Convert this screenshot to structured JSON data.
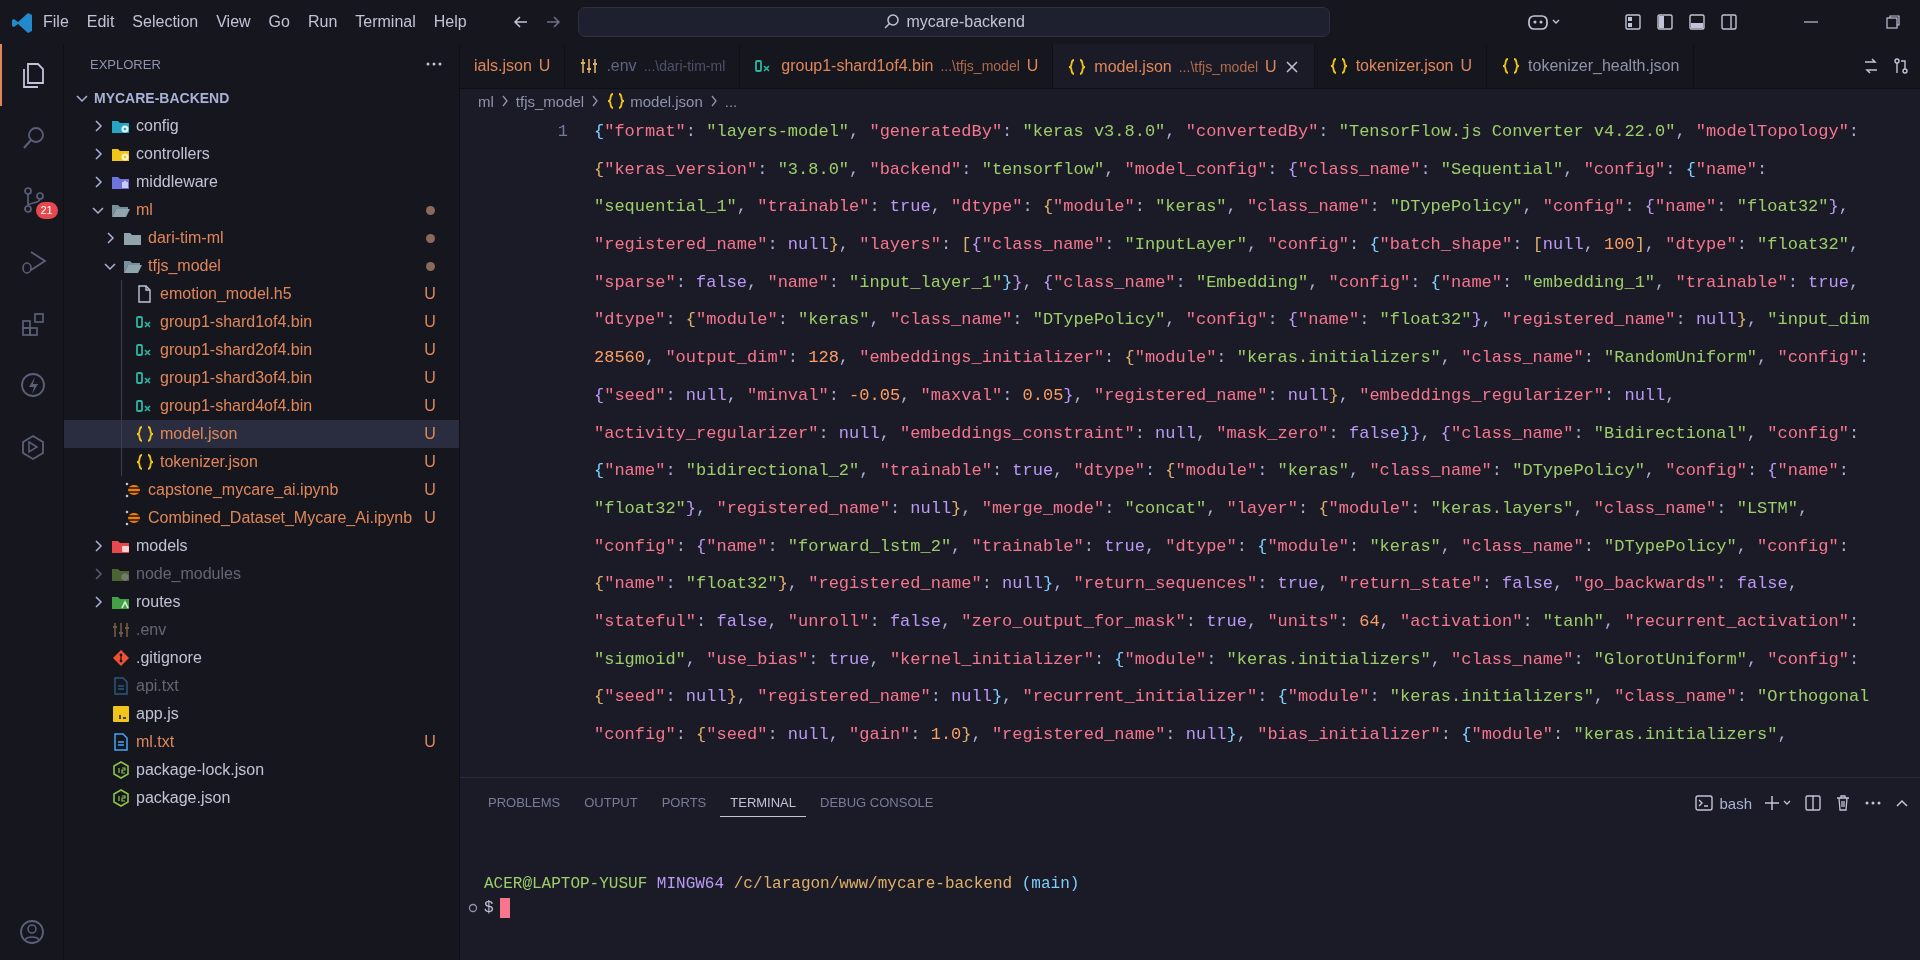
{
  "title_bar": {
    "menu": [
      "File",
      "Edit",
      "Selection",
      "View",
      "Go",
      "Run",
      "Terminal",
      "Help"
    ],
    "search": "mycare-backend"
  },
  "activity_bar": [
    {
      "kind": "files",
      "selected": true
    },
    {
      "kind": "search",
      "selected": false
    },
    {
      "kind": "source-control",
      "selected": false,
      "badge": "21"
    },
    {
      "kind": "run-debug",
      "selected": false
    },
    {
      "kind": "extensions",
      "selected": false
    },
    {
      "kind": "lightning",
      "selected": false
    },
    {
      "kind": "hexagon",
      "selected": false
    }
  ],
  "explorer": {
    "title": "EXPLORER",
    "root": {
      "label": "MYCARE-BACKEND",
      "expanded": true,
      "children": [
        {
          "label": "config",
          "kind": "folder-config",
          "expanded": false,
          "selected": false,
          "untracked": false,
          "ignored": false,
          "has_changes": false
        },
        {
          "label": "controllers",
          "kind": "folder-controllers",
          "expanded": false,
          "selected": false,
          "untracked": false,
          "ignored": false,
          "has_changes": false
        },
        {
          "label": "middleware",
          "kind": "folder-middleware",
          "expanded": false,
          "selected": false,
          "untracked": false,
          "ignored": false,
          "has_changes": false
        },
        {
          "label": "ml",
          "kind": "folder",
          "expanded": true,
          "selected": false,
          "untracked": true,
          "ignored": false,
          "has_changes": true,
          "children": [
            {
              "label": "dari-tim-ml",
              "kind": "folder",
              "expanded": false,
              "selected": false,
              "untracked": true,
              "ignored": false,
              "has_changes": true
            },
            {
              "label": "tfjs_model",
              "kind": "folder",
              "expanded": true,
              "selected": false,
              "untracked": true,
              "ignored": false,
              "has_changes": true,
              "children": [
                {
                  "label": "emotion_model.h5",
                  "kind": "file",
                  "selected": false,
                  "untracked": true,
                  "ignored": false,
                  "has_changes": false,
                  "badge": "U"
                },
                {
                  "label": "group1-shard1of4.bin",
                  "kind": "binary",
                  "selected": false,
                  "untracked": true,
                  "ignored": false,
                  "has_changes": false,
                  "badge": "U"
                },
                {
                  "label": "group1-shard2of4.bin",
                  "kind": "binary",
                  "selected": false,
                  "untracked": true,
                  "ignored": false,
                  "has_changes": false,
                  "badge": "U"
                },
                {
                  "label": "group1-shard3of4.bin",
                  "kind": "binary",
                  "selected": false,
                  "untracked": true,
                  "ignored": false,
                  "has_changes": false,
                  "badge": "U"
                },
                {
                  "label": "group1-shard4of4.bin",
                  "kind": "binary",
                  "selected": false,
                  "untracked": true,
                  "ignored": false,
                  "has_changes": false,
                  "badge": "U"
                },
                {
                  "label": "model.json",
                  "kind": "json",
                  "selected": true,
                  "untracked": true,
                  "ignored": false,
                  "has_changes": false,
                  "badge": "U"
                },
                {
                  "label": "tokenizer.json",
                  "kind": "json",
                  "selected": false,
                  "untracked": true,
                  "ignored": false,
                  "has_changes": false,
                  "badge": "U"
                }
              ]
            },
            {
              "label": "capstone_mycare_ai.ipynb",
              "kind": "notebook",
              "selected": false,
              "untracked": true,
              "ignored": false,
              "has_changes": false,
              "badge": "U"
            },
            {
              "label": "Combined_Dataset_Mycare_Ai.ipynb",
              "kind": "notebook",
              "selected": false,
              "untracked": true,
              "ignored": false,
              "has_changes": false,
              "badge": "U"
            }
          ]
        },
        {
          "label": "models",
          "kind": "folder-models",
          "expanded": false,
          "selected": false,
          "untracked": false,
          "ignored": false,
          "has_changes": false
        },
        {
          "label": "node_modules",
          "kind": "folder-node",
          "expanded": false,
          "selected": false,
          "untracked": false,
          "ignored": true,
          "has_changes": false
        },
        {
          "label": "routes",
          "kind": "folder-routes",
          "expanded": false,
          "selected": false,
          "untracked": false,
          "ignored": false,
          "has_changes": false
        },
        {
          "label": ".env",
          "kind": "env",
          "selected": false,
          "untracked": false,
          "ignored": true,
          "has_changes": false
        },
        {
          "label": ".gitignore",
          "kind": "git",
          "selected": false,
          "untracked": false,
          "ignored": false,
          "has_changes": false
        },
        {
          "label": "api.txt",
          "kind": "text",
          "selected": false,
          "untracked": false,
          "ignored": true,
          "has_changes": false
        },
        {
          "label": "app.js",
          "kind": "js",
          "selected": false,
          "untracked": false,
          "ignored": false,
          "has_changes": false
        },
        {
          "label": "ml.txt",
          "kind": "text",
          "selected": false,
          "untracked": true,
          "ignored": false,
          "has_changes": false,
          "badge": "U"
        },
        {
          "label": "package-lock.json",
          "kind": "nodejs",
          "selected": false,
          "untracked": false,
          "ignored": false,
          "has_changes": false
        },
        {
          "label": "package.json",
          "kind": "nodejs",
          "selected": false,
          "untracked": false,
          "ignored": false,
          "has_changes": false
        }
      ]
    }
  },
  "tabs": [
    {
      "label": "ials.json",
      "kind": "cut",
      "untracked": true,
      "ignored": false,
      "badge": "U",
      "selected": false
    },
    {
      "label": ".env",
      "kind": "env",
      "description": "...\\dari-tim-ml",
      "untracked": false,
      "ignored": true,
      "selected": false
    },
    {
      "label": "group1-shard1of4.bin",
      "kind": "binary",
      "description": "...\\tfjs_model",
      "untracked": true,
      "ignored": false,
      "badge": "U",
      "selected": false
    },
    {
      "label": "model.json",
      "kind": "json",
      "description": "...\\tfjs_model",
      "untracked": true,
      "ignored": false,
      "badge": "U",
      "selected": true
    },
    {
      "label": "tokenizer.json",
      "kind": "json",
      "untracked": true,
      "ignored": false,
      "badge": "U",
      "selected": false
    },
    {
      "label": "tokenizer_health.json",
      "kind": "json",
      "untracked": false,
      "ignored": false,
      "selected": false
    }
  ],
  "breadcrumb": [
    {
      "label": "ml",
      "kind": "folder"
    },
    {
      "label": "tfjs_model",
      "kind": "folder"
    },
    {
      "label": "model.json",
      "kind": "json"
    },
    {
      "label": "...",
      "kind": "more"
    }
  ],
  "editor": {
    "lines": [
      {
        "number": "1",
        "wrapped": [
          "{\"format\": \"layers-model\", \"generatedBy\": \"keras v3.8.0\", \"convertedBy\": \"TensorFlow.js Converter v4.22.0\", \"modelTopology\":",
          "{\"keras_version\": \"3.8.0\", \"backend\": \"tensorflow\", \"model_config\": {\"class_name\": \"Sequential\", \"config\": {\"name\":",
          "\"sequential_1\", \"trainable\": true, \"dtype\": {\"module\": \"keras\", \"class_name\": \"DTypePolicy\", \"config\": {\"name\": \"float32\"},",
          "\"registered_name\": null}, \"layers\": [{\"class_name\": \"InputLayer\", \"config\": {\"batch_shape\": [null, 100], \"dtype\": \"float32\",",
          "\"sparse\": false, \"name\": \"input_layer_1\"}}, {\"class_name\": \"Embedding\", \"config\": {\"name\": \"embedding_1\", \"trainable\": true,",
          "\"dtype\": {\"module\": \"keras\", \"class_name\": \"DTypePolicy\", \"config\": {\"name\": \"float32\"}, \"registered_name\": null}, \"input_dim",
          "28560, \"output_dim\": 128, \"embeddings_initializer\": {\"module\": \"keras.initializers\", \"class_name\": \"RandomUniform\", \"config\":",
          "{\"seed\": null, \"minval\": -0.05, \"maxval\": 0.05}, \"registered_name\": null}, \"embeddings_regularizer\": null,",
          "\"activity_regularizer\": null, \"embeddings_constraint\": null, \"mask_zero\": false}}, {\"class_name\": \"Bidirectional\", \"config\":",
          "{\"name\": \"bidirectional_2\", \"trainable\": true, \"dtype\": {\"module\": \"keras\", \"class_name\": \"DTypePolicy\", \"config\": {\"name\":",
          "\"float32\"}, \"registered_name\": null}, \"merge_mode\": \"concat\", \"layer\": {\"module\": \"keras.layers\", \"class_name\": \"LSTM\",",
          "\"config\": {\"name\": \"forward_lstm_2\", \"trainable\": true, \"dtype\": {\"module\": \"keras\", \"class_name\": \"DTypePolicy\", \"config\":",
          "{\"name\": \"float32\"}, \"registered_name\": null}, \"return_sequences\": true, \"return_state\": false, \"go_backwards\": false,",
          "\"stateful\": false, \"unroll\": false, \"zero_output_for_mask\": true, \"units\": 64, \"activation\": \"tanh\", \"recurrent_activation\":",
          "\"sigmoid\", \"use_bias\": true, \"kernel_initializer\": {\"module\": \"keras.initializers\", \"class_name\": \"GlorotUniform\", \"config\":",
          "{\"seed\": null}, \"registered_name\": null}, \"recurrent_initializer\": {\"module\": \"keras.initializers\", \"class_name\": \"Orthogonal",
          "\"config\": {\"seed\": null, \"gain\": 1.0}, \"registered_name\": null}, \"bias_initializer\": {\"module\": \"keras.initializers\","
        ]
      }
    ]
  },
  "panel": {
    "tabs": [
      {
        "label": "PROBLEMS",
        "selected": false
      },
      {
        "label": "OUTPUT",
        "selected": false
      },
      {
        "label": "PORTS",
        "selected": false
      },
      {
        "label": "TERMINAL",
        "selected": true
      },
      {
        "label": "DEBUG CONSOLE",
        "selected": false
      }
    ],
    "shell": "bash",
    "terminal": {
      "prompt_line": [
        {
          "text": "ACER@LAPTOP-YUSUF",
          "kind": "user"
        },
        {
          "text": "MINGW64",
          "kind": "system"
        },
        {
          "text": "/c/laragon/www/mycare-backend",
          "kind": "path"
        },
        {
          "text": "(main)",
          "kind": "branch"
        }
      ],
      "prompt": "$"
    }
  }
}
